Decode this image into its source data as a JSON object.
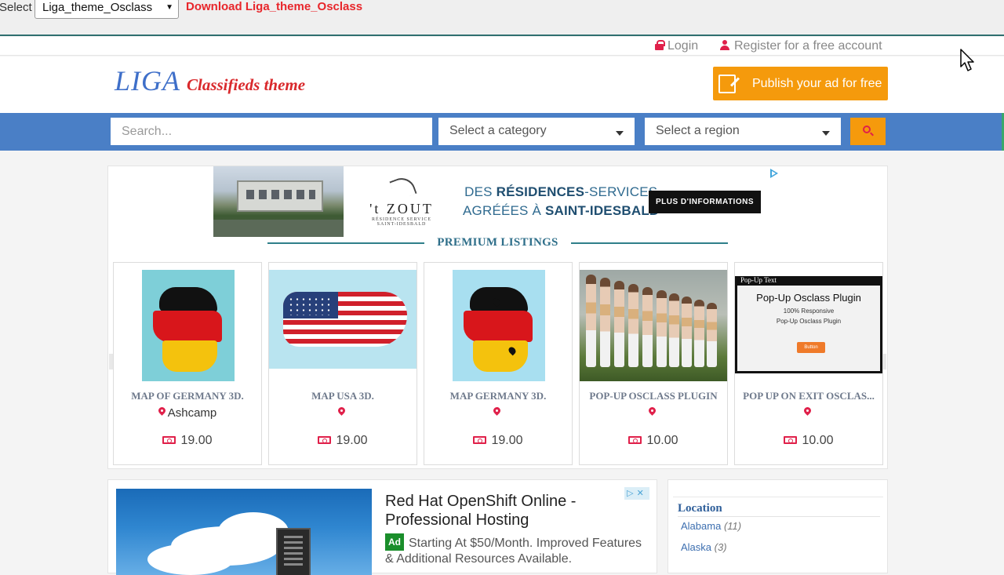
{
  "demo_bar": {
    "select_label": "Select",
    "select_value": "Liga_theme_Osclass",
    "download_link": "Download Liga_theme_Osclass"
  },
  "top_links": {
    "login": "Login",
    "register": "Register for a free account"
  },
  "logo": {
    "main": "LIGA",
    "sub": "Classifieds theme"
  },
  "publish_button": "Publish your ad for free",
  "search": {
    "placeholder": "Search...",
    "category": "Select a category",
    "region": "Select a region"
  },
  "ad_banner": {
    "brand": "'t ZOUT",
    "brand_sub": "RÉSIDENCE SERVICE",
    "brand_sub2": "SAINT-IDESBALD",
    "line1a": "DES ",
    "line1b": "RÉSIDENCES",
    "line1c": "-SERVICES",
    "line2a": "AGRÉÉES À ",
    "line2b": "SAINT-IDESBALD",
    "cta": "PLUS D'INFORMATIONS"
  },
  "premium": {
    "title": "PREMIUM LISTINGS",
    "cards": [
      {
        "title": "MAP OF GERMANY 3D.",
        "location": "Ashcamp",
        "price": "19.00"
      },
      {
        "title": "MAP USA 3D.",
        "location": "",
        "price": "19.00"
      },
      {
        "title": "MAP GERMANY 3D.",
        "location": "",
        "price": "19.00"
      },
      {
        "title": "POP-UP OSCLASS PLUGIN",
        "location": "",
        "price": "10.00"
      },
      {
        "title": "POP UP ON EXIT OSCLAS...",
        "location": "",
        "price": "10.00"
      }
    ],
    "popup_thumb": {
      "head": "Pop-Up Text",
      "title": "Pop-Up Osclass Plugin",
      "line1": "100% Responsive",
      "line2": "Pop-Up Osclass Plugin",
      "button": "Button"
    }
  },
  "ad2": {
    "title_line1": "Red Hat OpenShift Online -",
    "title_line2": "Professional Hosting",
    "badge": "Ad",
    "text": "Starting At $50/Month. Improved Features & Additional Resources Available."
  },
  "sidebar": {
    "title": "Location",
    "items": [
      {
        "name": "Alabama",
        "count": "(11)"
      },
      {
        "name": "Alaska",
        "count": "(3)"
      }
    ]
  },
  "colors": {
    "brand_blue": "#4a7fc6",
    "accent_orange": "#f59a0c",
    "accent_red": "#e0204a"
  }
}
